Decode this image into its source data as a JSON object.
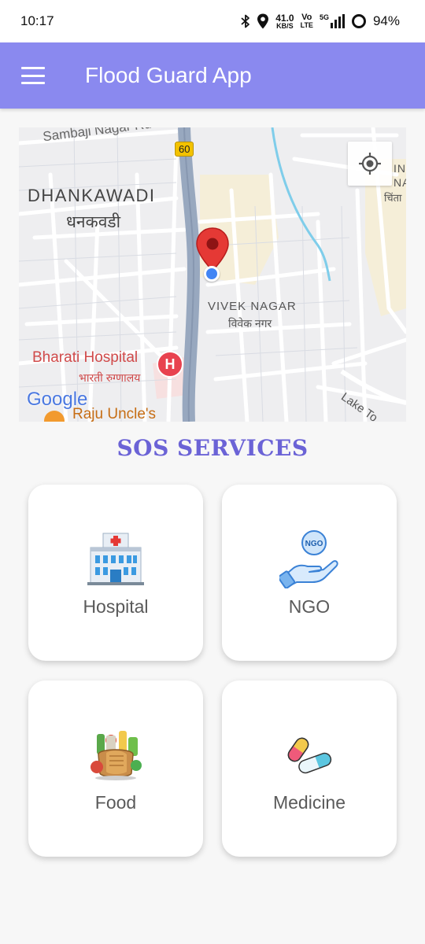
{
  "status_bar": {
    "time": "10:17",
    "net_speed_value": "41.0",
    "net_speed_unit": "KB/S",
    "volte_top": "Vo",
    "volte_bottom": "LTE",
    "network": "5G",
    "battery": "94%"
  },
  "app_bar": {
    "title": "Flood Guard App"
  },
  "map": {
    "labels": {
      "top_road": "Sambaji Nagar Rd",
      "highway_shield": "60",
      "area_en": "DHANKAWADI",
      "area_hi": "धनकवडी",
      "vivek_en": "VIVEK NAGAR",
      "vivek_hi": "विवेक नगर",
      "hospital_en": "Bharati Hospital",
      "hospital_hi": "भारती रुग्णालय",
      "hospital_marker": "H",
      "right_en_1": "IN",
      "right_en_2": "NA",
      "right_hi": "चिंता",
      "lake_road": "Lake To",
      "google": "Google",
      "poi": "Raju Uncle's"
    }
  },
  "sos": {
    "title": "SOS SERVICES",
    "services": [
      {
        "label": "Hospital",
        "icon": "hospital-building-icon"
      },
      {
        "label": "NGO",
        "icon": "ngo-hand-icon",
        "badge": "NGO"
      },
      {
        "label": "Food",
        "icon": "food-groceries-icon"
      },
      {
        "label": "Medicine",
        "icon": "medicine-capsule-icon"
      }
    ]
  },
  "colors": {
    "app_bar": "#8a89ef",
    "sos_title": "#6b63d6",
    "map_pin": "#e53935",
    "user_dot": "#4285f4"
  }
}
